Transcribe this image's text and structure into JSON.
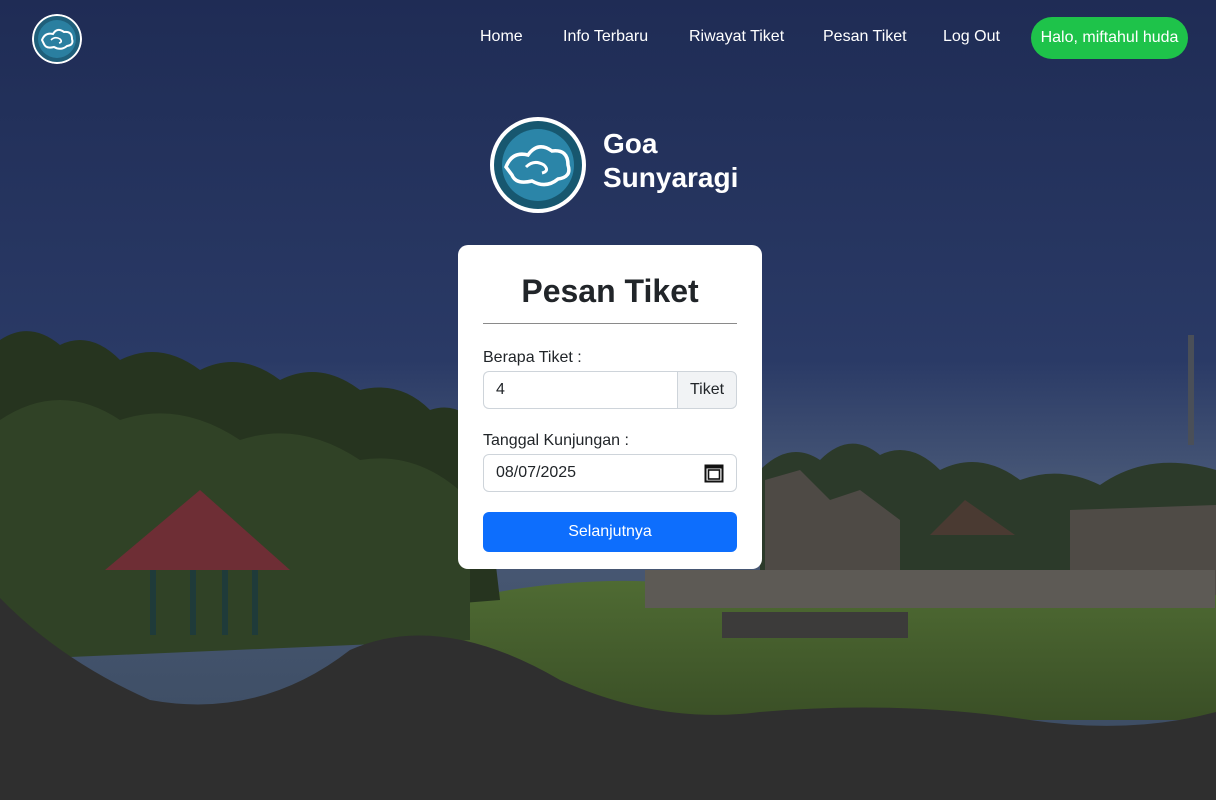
{
  "nav": {
    "links": [
      "Home",
      "Info Terbaru",
      "Riwayat Tiket",
      "Pesan Tiket",
      "Log Out"
    ],
    "greeting": "Halo, miftahul huda"
  },
  "brand": {
    "line1": "Goa",
    "line2": "Sunyaragi"
  },
  "form": {
    "title": "Pesan Tiket",
    "qty_label": "Berapa Tiket :",
    "qty_value": "4",
    "qty_addon": "Tiket",
    "date_label": "Tanggal Kunjungan :",
    "date_value": "08/07/2025",
    "submit_label": "Selanjutnya"
  },
  "colors": {
    "greeting_bg": "#1ec34a",
    "primary": "#0d6efd",
    "footer_wave": "#2f2f2f"
  },
  "icons": {
    "logo": "mega-mendung-cloud-logo",
    "calendar": "calendar-icon"
  }
}
